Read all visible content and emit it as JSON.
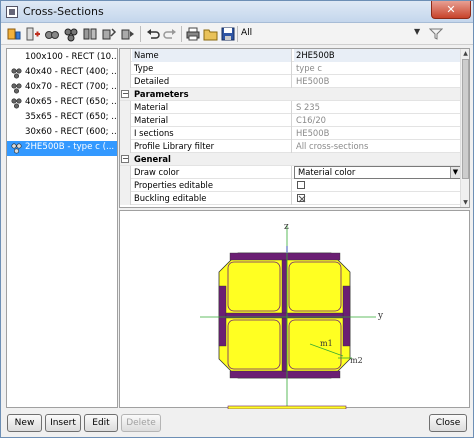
{
  "window": {
    "title": "Cross-Sections",
    "close_glyph": "✕"
  },
  "toolbar": {
    "filter_value": "All",
    "filter_arrow": "▼",
    "icons": [
      "new-section-icon",
      "insert-icon",
      "properties-icon",
      "group-icon",
      "ungroup-icon",
      "edit-icon",
      "delete-icon",
      "undo-icon",
      "redo-icon",
      "print-icon",
      "open-icon",
      "save-icon",
      "filter-icon"
    ]
  },
  "tree": {
    "items": [
      {
        "label": "100x100 - RECT (10...",
        "icon": "rect-section-icon"
      },
      {
        "label": "40x40 - RECT (400; ...",
        "icon": "rebar-section-icon"
      },
      {
        "label": "40x70 - RECT (700; ...",
        "icon": "rebar-section-icon"
      },
      {
        "label": "40x65 - RECT (650; ...",
        "icon": "rebar-section-icon"
      },
      {
        "label": "35x65 - RECT (650; ...",
        "icon": "rect-section-icon"
      },
      {
        "label": "30x60 - RECT (600; ...",
        "icon": "rect-section-icon"
      },
      {
        "label": "2HE500B - type c (...",
        "icon": "composite-section-icon",
        "selected": true
      }
    ]
  },
  "properties": {
    "rows": [
      {
        "kind": "head",
        "name": "Name",
        "value": "2HE500B"
      },
      {
        "kind": "row",
        "name": "Type",
        "value": "type c"
      },
      {
        "kind": "row",
        "name": "Detailed",
        "value": "HE500B"
      },
      {
        "kind": "section",
        "name": "Parameters",
        "toggle": "−"
      },
      {
        "kind": "row",
        "name": "Material",
        "value": "S 235"
      },
      {
        "kind": "row",
        "name": "Material",
        "value": "C16/20"
      },
      {
        "kind": "row",
        "name": "I sections",
        "value": "HE500B"
      },
      {
        "kind": "row",
        "name": "Profile Library filter",
        "value": "All cross-sections"
      },
      {
        "kind": "section",
        "name": "General",
        "toggle": "−"
      },
      {
        "kind": "combo",
        "name": "Draw color",
        "value": "Material color"
      },
      {
        "kind": "check",
        "name": "Properties editable",
        "checked": false
      },
      {
        "kind": "check",
        "name": "Buckling editable",
        "checked": true
      }
    ]
  },
  "drawing": {
    "axis_z": "z",
    "axis_y": "y",
    "label_m1": "m1",
    "label_m2": "m2",
    "colors": {
      "concrete": "#ffff22",
      "steel": "#6b1f73",
      "axis": "#33aa33",
      "outline": "#333333"
    }
  },
  "buttons": {
    "new": "New",
    "insert": "Insert",
    "edit": "Edit",
    "delete": "Delete",
    "close": "Close"
  }
}
